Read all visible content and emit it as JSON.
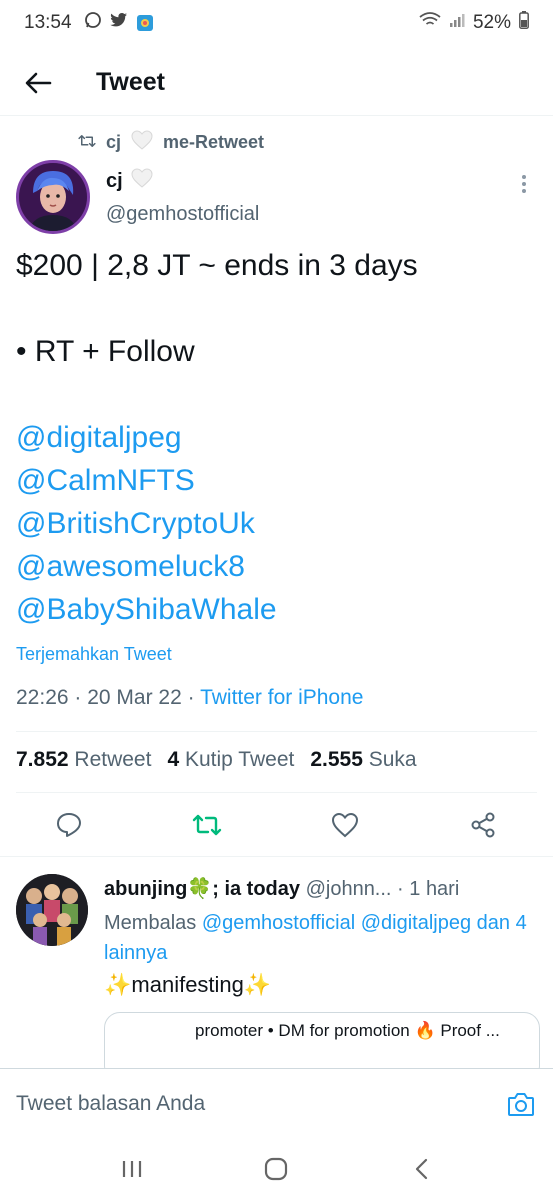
{
  "status_bar": {
    "time": "13:54",
    "battery": "52%"
  },
  "header": {
    "title": "Tweet"
  },
  "retweet": {
    "user": "cj",
    "label": "me-Retweet"
  },
  "tweet": {
    "author_name": "cj",
    "author_handle": "@gemhostofficial",
    "line1": "$200 | 2,8 JT ~ ends in 3 days",
    "line2": "• RT + Follow",
    "mentions": [
      "@digitaljpeg",
      "@CalmNFTS",
      "@BritishCryptoUk",
      "@awesomeluck8",
      "@BabyShibaWhale"
    ],
    "translate": "Terjemahkan Tweet",
    "time": "22:26 · 20 Mar 22 · ",
    "source": "Twitter for iPhone"
  },
  "stats": {
    "retweets": "7.852",
    "retweets_label": "Retweet",
    "quotes": "4",
    "quotes_label": "Kutip Tweet",
    "likes": "2.555",
    "likes_label": "Suka"
  },
  "reply": {
    "name": "abunjing🍀; ia today",
    "handle": " @johnn...",
    "time": " · 1 hari",
    "replying_prefix": "Membalas ",
    "replying_mentions": "@gemhostofficial @digitaljpeg",
    "replying_suffix": "dan 4 lainnya",
    "text": "✨manifesting✨",
    "quote_snippet": "promoter • DM for promotion 🔥 Proof ..."
  },
  "composer": {
    "placeholder": "Tweet balasan Anda"
  },
  "colors": {
    "accent": "#1d9bf0",
    "retweet_green": "#00ba7c",
    "secondary_text": "#536471"
  },
  "icons": [
    "back-arrow-icon",
    "retweet-icon",
    "heart-icon",
    "more-icon",
    "reply-icon",
    "share-icon",
    "camera-icon"
  ]
}
